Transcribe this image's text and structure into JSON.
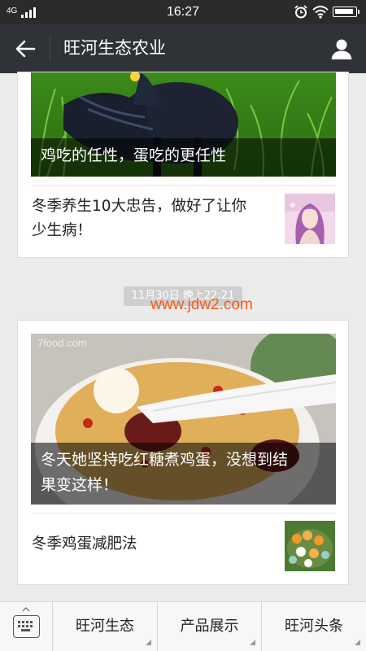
{
  "status_bar": {
    "network": "4G",
    "time": "16:27",
    "icons": [
      "signal-icon",
      "alarm-icon",
      "wifi-icon",
      "battery-icon"
    ]
  },
  "nav": {
    "title": "旺河生态农业",
    "back_icon": "back-arrow-icon",
    "profile_icon": "user-icon"
  },
  "feed": [
    {
      "hero_caption": "鸡吃的任性，蛋吃的更任性",
      "items": [
        {
          "title_line1": "冬季养生10大忠告，做好了让你",
          "title_line2": "少生病！"
        }
      ]
    },
    {
      "timestamp": "11月30日 晚上22:21",
      "hero_watermark": "7food.com",
      "hero_caption_line1": "冬天她坚持吃红糖煮鸡蛋，没想到结",
      "hero_caption_line2": "果变这样！",
      "items": [
        {
          "title": "冬季鸡蛋减肥法"
        }
      ]
    }
  ],
  "overlay_watermark": "www.jdw2.com",
  "bottom_menu": {
    "keyboard_icon": "keyboard-icon",
    "tabs": [
      "旺河生态",
      "产品展示",
      "旺河头条"
    ]
  },
  "colors": {
    "nav_bg": "#2f3237",
    "status_bg": "#2b2b2b",
    "page_bg": "#ebebeb",
    "watermark": "#f25a14"
  }
}
